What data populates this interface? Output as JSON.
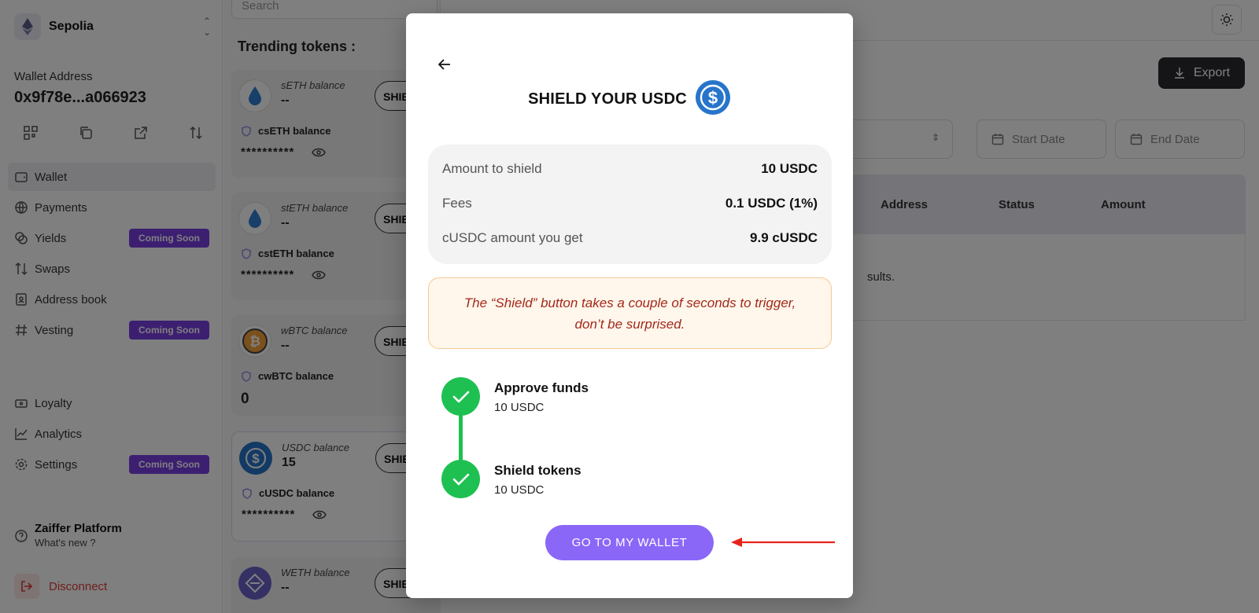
{
  "sidebar": {
    "network": "Sepolia",
    "wallet_label": "Wallet Address",
    "wallet_address": "0x9f78e...a066923",
    "nav": [
      {
        "label": "Wallet"
      },
      {
        "label": "Payments"
      },
      {
        "label": "Yields",
        "badge": "Coming Soon"
      },
      {
        "label": "Swaps"
      },
      {
        "label": "Address book"
      },
      {
        "label": "Vesting",
        "badge": "Coming Soon"
      },
      {
        "label": "Loyalty"
      },
      {
        "label": "Analytics"
      },
      {
        "label": "Settings",
        "badge": "Coming Soon"
      }
    ],
    "platform_title": "Zaiffer Platform",
    "platform_sub": "What's new ?",
    "disconnect": "Disconnect"
  },
  "tokens": {
    "search_placeholder": "Search",
    "heading": "Trending tokens :",
    "shield_label": "SHIELD",
    "cards": [
      {
        "label": "sETH balance",
        "value": "--",
        "conf_label": "csETH balance",
        "conf_value": "**********"
      },
      {
        "label": "stETH balance",
        "value": "--",
        "conf_label": "cstETH balance",
        "conf_value": "**********"
      },
      {
        "label": "wBTC balance",
        "value": "--",
        "conf_label": "cwBTC balance",
        "conf_value": "0"
      },
      {
        "label": "USDC balance",
        "value": "15",
        "conf_label": "cUSDC balance",
        "conf_value": "**********"
      },
      {
        "label": "WETH balance",
        "value": "--"
      }
    ]
  },
  "main": {
    "export": "Export",
    "start_date": "Start Date",
    "end_date": "End Date",
    "columns": [
      "Address",
      "Status",
      "Amount"
    ],
    "no_results": "sults."
  },
  "modal": {
    "title": "SHIELD YOUR USDC",
    "summary": [
      {
        "label": "Amount to shield",
        "value": "10 USDC"
      },
      {
        "label": "Fees",
        "value": "0.1 USDC (1%)"
      },
      {
        "label": "cUSDC amount you get",
        "value": "9.9 cUSDC"
      }
    ],
    "note_line1": "The “Shield” button takes a couple of seconds to trigger,",
    "note_line2": "don’t be surprised.",
    "steps": [
      {
        "title": "Approve funds",
        "sub": "10 USDC"
      },
      {
        "title": "Shield tokens",
        "sub": "10 USDC"
      }
    ],
    "button": "GO TO MY WALLET"
  },
  "colors": {
    "accent": "#8b67f8",
    "success": "#1fc052",
    "badge": "#7b3fe4",
    "warning_text": "#a3291a",
    "arrow": "#e8231a"
  }
}
